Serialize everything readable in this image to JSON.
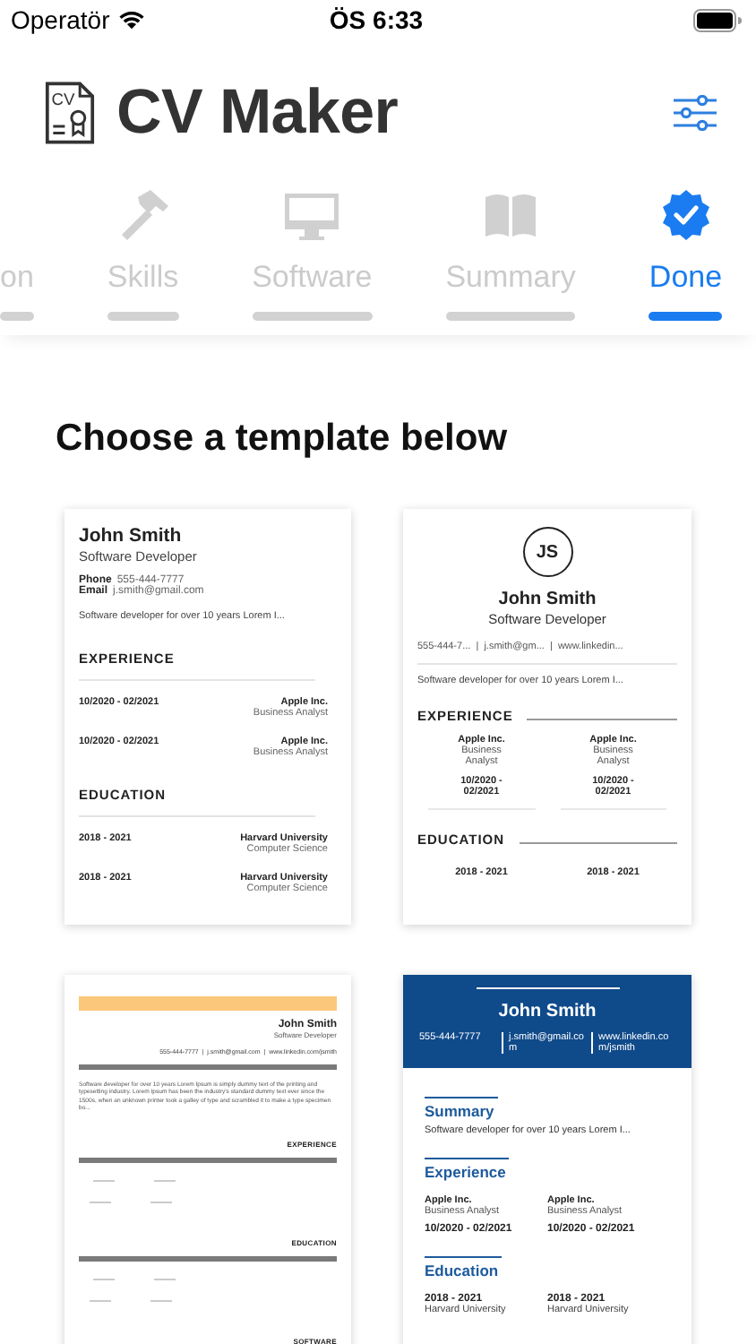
{
  "status_bar": {
    "carrier": "Operatör",
    "time": "ÖS 6:33"
  },
  "header": {
    "logo_text": "CV",
    "title": "CV Maker"
  },
  "tabs": [
    {
      "label": "on",
      "selected": false
    },
    {
      "label": "Skills",
      "selected": false
    },
    {
      "label": "Software",
      "selected": false
    },
    {
      "label": "Summary",
      "selected": false
    },
    {
      "label": "Done",
      "selected": true
    }
  ],
  "heading": "Choose a template below",
  "templates": [
    {
      "kind": "classic",
      "name": "John Smith",
      "title": "Software Developer",
      "contacts": [
        {
          "label": "Phone",
          "value": "555-444-7777"
        },
        {
          "label": "Email",
          "value": "j.smith@gmail.com"
        }
      ],
      "summary": "Software developer for over 10 years Lorem I...",
      "sections": [
        {
          "heading": "EXPERIENCE",
          "entries": [
            {
              "date": "10/2020 - 02/2021",
              "org": "Apple Inc.",
              "role": "Business Analyst"
            },
            {
              "date": "10/2020 - 02/2021",
              "org": "Apple Inc.",
              "role": "Business Analyst"
            }
          ]
        },
        {
          "heading": "EDUCATION",
          "entries": [
            {
              "date": "2018 - 2021",
              "org": "Harvard University",
              "role": "Computer Science"
            },
            {
              "date": "2018 - 2021",
              "org": "Harvard University",
              "role": "Computer Science"
            }
          ]
        }
      ]
    },
    {
      "kind": "centered",
      "initials": "JS",
      "name": "John Smith",
      "title": "Software Developer",
      "contact_line": "555-444-7...  |  j.smith@gm...  |  www.linkedin...",
      "summary": "Software developer for over 10 years Lorem I...",
      "sections": [
        {
          "heading": "EXPERIENCE",
          "entries": [
            {
              "org": "Apple Inc.",
              "role": "Business Analyst",
              "date": "10/2020 - 02/2021"
            },
            {
              "org": "Apple Inc.",
              "role": "Business Analyst",
              "date": "10/2020 - 02/2021"
            }
          ]
        },
        {
          "heading": "EDUCATION",
          "entries": [
            {
              "date": "2018 - 2021"
            },
            {
              "date": "2018 - 2021"
            }
          ]
        }
      ]
    },
    {
      "kind": "banner",
      "name": "John Smith",
      "title": "Software Developer",
      "contact_line": "555-444-7777  |  j.smith@gmail.com  |  www.linkedin.com/jsmith",
      "summary": "Software developer for over 10 years Lorem Ipsum is simply dummy text of the printing and typesetting industry. Lorem Ipsum has been the industry's standard dummy text ever since the 1500s, when an unknown printer took a galley of type and scrambled it to make a type specimen bo...",
      "sections": [
        {
          "heading": "EXPERIENCE"
        },
        {
          "heading": "EDUCATION"
        },
        {
          "heading": "SOFTWARE"
        }
      ]
    },
    {
      "kind": "band",
      "name": "John Smith",
      "contacts": [
        "555-444-7777",
        "j.smith@gmail.com",
        "www.linkedin.com/jsmith"
      ],
      "sections": [
        {
          "heading": "Summary",
          "text": "Software developer for over 10 years Lorem I..."
        },
        {
          "heading": "Experience",
          "entries": [
            {
              "org": "Apple Inc.",
              "role": "Business Analyst",
              "date": "10/2020 - 02/2021"
            },
            {
              "org": "Apple Inc.",
              "role": "Business Analyst",
              "date": "10/2020 - 02/2021"
            }
          ]
        },
        {
          "heading": "Education",
          "entries": [
            {
              "date": "2018 - 2021",
              "org": "Harvard University"
            },
            {
              "date": "2018 - 2021",
              "org": "Harvard University"
            }
          ]
        }
      ]
    }
  ]
}
